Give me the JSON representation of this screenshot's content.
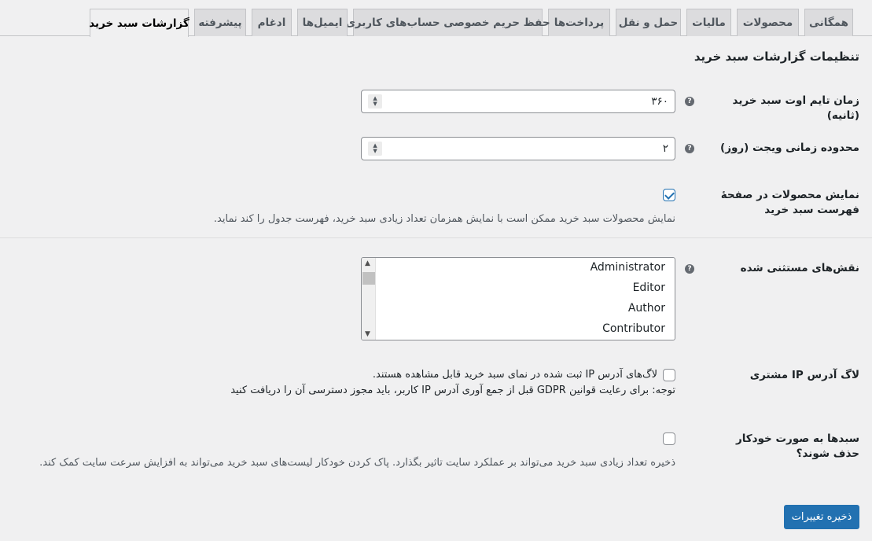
{
  "tabs": [
    {
      "label": "همگانی"
    },
    {
      "label": "محصولات"
    },
    {
      "label": "مالیات"
    },
    {
      "label": "حمل و نقل"
    },
    {
      "label": "پرداخت‌ها"
    },
    {
      "label": "حفظ حریم خصوصی حساب‌های کاربری"
    },
    {
      "label": "ایمیل‌ها"
    },
    {
      "label": "ادغام"
    },
    {
      "label": "پیشرفته"
    },
    {
      "label": "گزارشات سبد خرید",
      "active": true
    }
  ],
  "page": {
    "section_title": "تنظیمات گزارشات سبد خرید"
  },
  "settings": {
    "timeout": {
      "label": "زمان تایم اوت سبد خرید (ثانیه)",
      "value": "۳۶۰"
    },
    "widget_range": {
      "label": "محدوده زمانی ویجت (روز)",
      "value": "۲"
    },
    "show_products": {
      "label": "نمایش محصولات در صفحهٔ فهرست سبد خرید",
      "checked": true,
      "description": "نمایش محصولات سبد خرید ممکن است با نمایش همزمان تعداد زیادی سبد خرید، فهرست جدول را کند نماید."
    },
    "excluded_roles": {
      "label": "نقش‌های مستثنی شده",
      "options": [
        "Administrator",
        "Editor",
        "Author",
        "Contributor"
      ]
    },
    "log_ip": {
      "label": "لاگ آدرس IP مشتری",
      "checked": false,
      "option_text": "لاگ‌های آدرس IP ثبت شده در نمای سبد خرید قابل مشاهده هستند.",
      "note": "توجه: برای رعایت قوانین GDPR قبل از جمع آوری آدرس IP کاربر، باید مجوز دسترسی آن را دریافت کنید"
    },
    "auto_delete": {
      "label": "سبدها به صورت خودکار حذف شوند؟",
      "checked": false,
      "description": "ذخیره تعداد زیادی سبد خرید می‌تواند بر عملکرد سایت تاثیر بگذارد. پاک کردن خودکار لیست‌های سبد خرید می‌تواند به افزایش سرعت سایت کمک کند."
    }
  },
  "actions": {
    "save_label": "ذخیره تغییرات"
  },
  "colors": {
    "accent": "#2271b1",
    "background": "#f0f0f1"
  }
}
